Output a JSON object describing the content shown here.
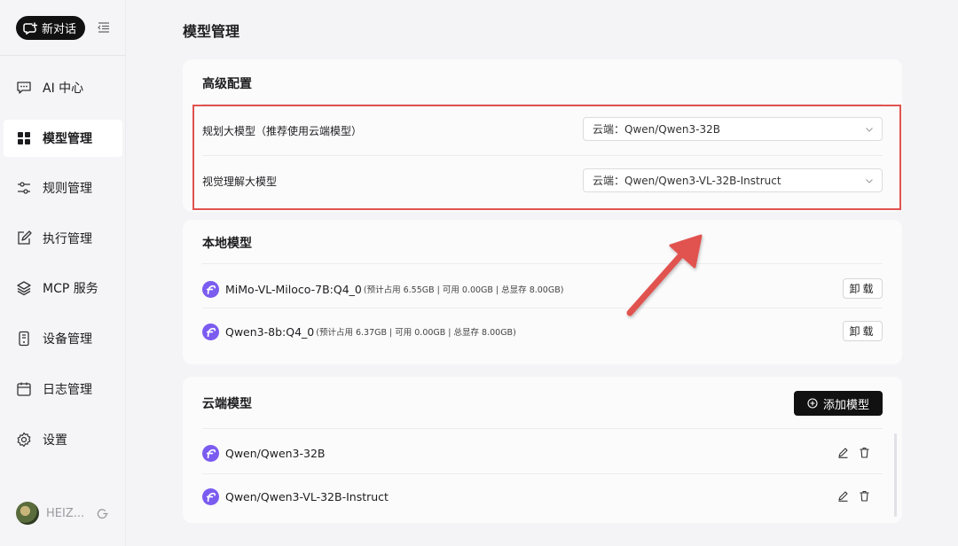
{
  "sidebar": {
    "new_chat_label": "新对话",
    "items": [
      {
        "label": "AI 中心",
        "icon": "chat-icon"
      },
      {
        "label": "模型管理",
        "icon": "grid-icon",
        "active": true
      },
      {
        "label": "规则管理",
        "icon": "sliders-icon"
      },
      {
        "label": "执行管理",
        "icon": "edit-icon"
      },
      {
        "label": "MCP 服务",
        "icon": "layers-icon"
      },
      {
        "label": "设备管理",
        "icon": "device-icon"
      },
      {
        "label": "日志管理",
        "icon": "calendar-icon"
      },
      {
        "label": "设置",
        "icon": "gear-icon"
      }
    ],
    "user_name": "HEIZ..."
  },
  "main": {
    "page_title": "模型管理",
    "advanced": {
      "title": "高级配置",
      "rows": [
        {
          "label": "规划大模型（推荐使用云端模型）",
          "value": "云端：Qwen/Qwen3-32B"
        },
        {
          "label": "视觉理解大模型",
          "value": "云端：Qwen/Qwen3-VL-32B-Instruct"
        }
      ]
    },
    "local": {
      "title": "本地模型",
      "rows": [
        {
          "name": "MiMo-VL-Miloco-7B:Q4_0",
          "meta": "(预计占用 6.55GB | 可用 0.00GB | 总显存 8.00GB)",
          "action": "卸载"
        },
        {
          "name": "Qwen3-8b:Q4_0",
          "meta": "(预计占用 6.37GB | 可用 0.00GB | 总显存 8.00GB)",
          "action": "卸载"
        }
      ]
    },
    "cloud": {
      "title": "云端模型",
      "add_label": "添加模型",
      "rows": [
        {
          "name": "Qwen/Qwen3-32B"
        },
        {
          "name": "Qwen/Qwen3-VL-32B-Instruct"
        }
      ]
    }
  },
  "colors": {
    "annotation": "#e1524f",
    "brand_icon": "#7b5cf0",
    "primary_button": "#111111"
  }
}
